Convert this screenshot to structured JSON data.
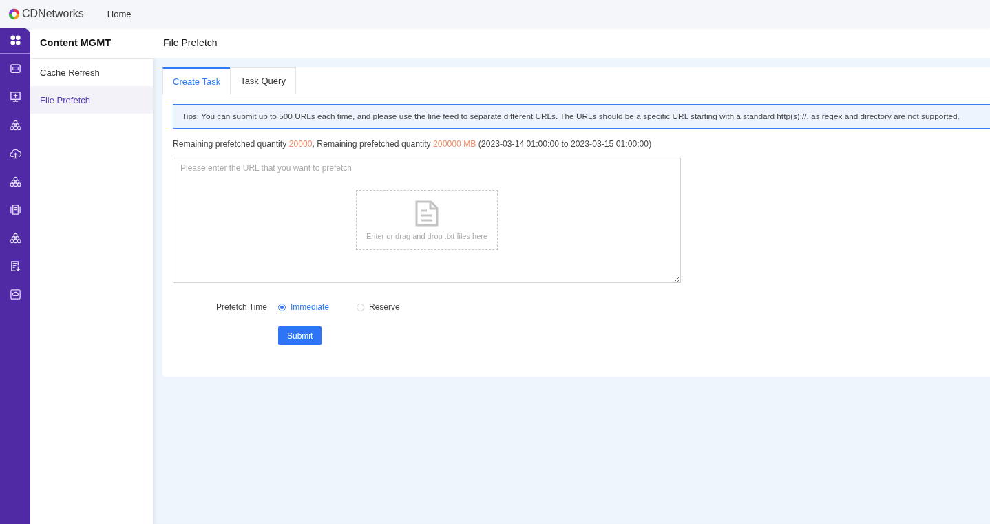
{
  "header": {
    "brand": "CDNetworks",
    "nav": [
      "Home"
    ]
  },
  "rail": [
    {
      "kind": "grid",
      "selected": true
    },
    {
      "kind": "card",
      "selected": false
    },
    {
      "kind": "monitor",
      "selected": false
    },
    {
      "kind": "cluster",
      "selected": false
    },
    {
      "kind": "cloud-up",
      "selected": false
    },
    {
      "kind": "cluster",
      "selected": false
    },
    {
      "kind": "server",
      "selected": false
    },
    {
      "kind": "cluster",
      "selected": false
    },
    {
      "kind": "doc-down",
      "selected": false
    },
    {
      "kind": "cloud-box",
      "selected": false
    }
  ],
  "sidebar": {
    "title": "Content MGMT",
    "items": [
      {
        "label": "Cache Refresh",
        "selected": false
      },
      {
        "label": "File Prefetch",
        "selected": true
      }
    ]
  },
  "page_title": "File Prefetch",
  "tabs": [
    {
      "label": "Create Task",
      "selected": true
    },
    {
      "label": "Task Query",
      "selected": false
    }
  ],
  "tips": "Tips: You can submit up to 500 URLs each time, and please use the line feed to separate different URLs. The URLs should be a specific URL starting with a standard http(s)://, as regex and directory are not supported.",
  "quota_line": [
    {
      "text": "Remaining prefetched quantity ",
      "highlight": false
    },
    {
      "text": "20000",
      "highlight": true
    },
    {
      "text": ", Remaining prefetched quantity ",
      "highlight": false
    },
    {
      "text": "200000 MB",
      "highlight": true
    },
    {
      "text": " (2023-03-14 01:00:00 to 2023-03-15 01:00:00)",
      "highlight": false
    }
  ],
  "url_field": {
    "placeholder": "Please enter the URL that you want to prefetch"
  },
  "drop_zone": {
    "text": "Enter or drag and drop .txt files here"
  },
  "prefetch_time": {
    "label": "Prefetch Time",
    "options": [
      {
        "label": "Immediate",
        "selected": true
      },
      {
        "label": "Reserve",
        "selected": false
      }
    ]
  },
  "submit": "Submit"
}
